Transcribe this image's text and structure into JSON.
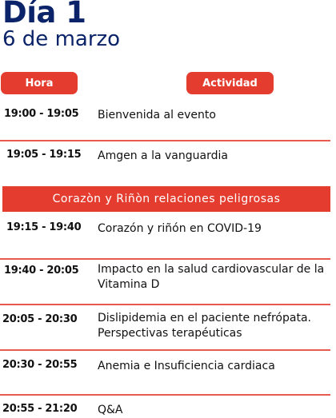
{
  "header": {
    "title": "Día 1",
    "date": "6 de marzo"
  },
  "columns": {
    "time": "Hora",
    "activity": "Actividad"
  },
  "colors": {
    "navy": "#0b2368",
    "accent": "#e43d30"
  },
  "section_banner": "Corazòn y Riñòn relaciones peligrosas",
  "rows": [
    {
      "time": "19:00 - 19:05",
      "activity": "Bienvenida al evento"
    },
    {
      "time": "19:05 - 19:15",
      "activity": "Amgen a la vanguardia"
    },
    {
      "time": "19:15 - 19:40",
      "activity": "Corazón y riñón en COVID-19"
    },
    {
      "time": "19:40 - 20:05",
      "activity": "Impacto  en la salud cardiovascular de la Vitamina D"
    },
    {
      "time": "20:05 - 20:30",
      "activity": "Dislipidemia en el paciente nefrópata. Perspectivas terapéuticas"
    },
    {
      "time": "20:30 - 20:55",
      "activity": "Anemia e Insuficiencia cardiaca"
    },
    {
      "time": "20:55 - 21:20",
      "activity": "Q&A"
    }
  ]
}
